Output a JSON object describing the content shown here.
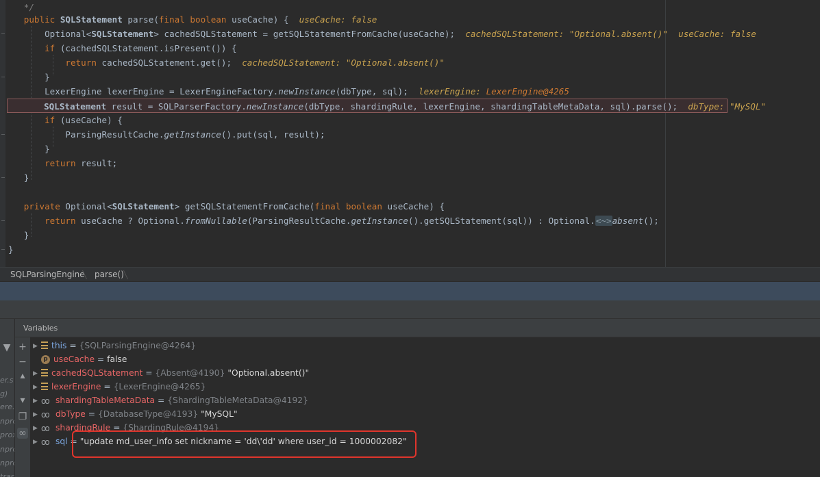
{
  "editor": {
    "lines": [
      {
        "key": "l0",
        "parts": [
          {
            "t": "   */",
            "c": "cm"
          }
        ]
      },
      {
        "key": "l1",
        "parts": [
          {
            "t": "   public ",
            "c": "kw"
          },
          {
            "t": "SQLStatement",
            "c": "bold"
          },
          {
            "t": " parse(",
            "c": ""
          },
          {
            "t": "final boolean ",
            "c": "kw"
          },
          {
            "t": "useCache) {  ",
            "c": ""
          },
          {
            "t": "useCache: false",
            "c": "hint"
          }
        ]
      },
      {
        "key": "l2",
        "parts": [
          {
            "t": "       Optional<",
            "c": ""
          },
          {
            "t": "SQLStatement",
            "c": "bold"
          },
          {
            "t": "> cachedSQLStatement = getSQLStatementFromCache(useCache);  ",
            "c": ""
          },
          {
            "t": "cachedSQLStatement: \"Optional.absent()\"  useCache: false",
            "c": "hint"
          }
        ]
      },
      {
        "key": "l3",
        "parts": [
          {
            "t": "       ",
            "c": ""
          },
          {
            "t": "if ",
            "c": "kw"
          },
          {
            "t": "(cachedSQLStatement.isPresent()) {",
            "c": ""
          }
        ]
      },
      {
        "key": "l4",
        "parts": [
          {
            "t": "           ",
            "c": ""
          },
          {
            "t": "return ",
            "c": "kw"
          },
          {
            "t": "cachedSQLStatement.get();  ",
            "c": ""
          },
          {
            "t": "cachedSQLStatement: \"Optional.absent()\"",
            "c": "hint"
          }
        ]
      },
      {
        "key": "l5",
        "parts": [
          {
            "t": "       }",
            "c": ""
          }
        ]
      },
      {
        "key": "l6",
        "parts": [
          {
            "t": "       LexerEngine lexerEngine = LexerEngineFactory.",
            "c": ""
          },
          {
            "t": "newInstance",
            "c": "it"
          },
          {
            "t": "(dbType, sql);  ",
            "c": ""
          },
          {
            "t": "lexerEngine: ",
            "c": "hint"
          },
          {
            "t": "LexerEngine@4265",
            "c": "hint-orange"
          }
        ]
      },
      {
        "key": "l7",
        "parts": [
          {
            "t": "       ",
            "c": ""
          },
          {
            "t": "SQLStatement",
            "c": "bold"
          },
          {
            "t": " result = SQLParserFactory.",
            "c": ""
          },
          {
            "t": "newInstance",
            "c": "it"
          },
          {
            "t": "(dbType, shardingRule, lexerEngine, shardingTableMetaData, sql).parse();  ",
            "c": ""
          },
          {
            "t": "dbType: \"MySQL\"",
            "c": "hint"
          }
        ]
      },
      {
        "key": "l8",
        "parts": [
          {
            "t": "       ",
            "c": ""
          },
          {
            "t": "if ",
            "c": "kw"
          },
          {
            "t": "(useCache) {",
            "c": ""
          }
        ]
      },
      {
        "key": "l9",
        "parts": [
          {
            "t": "           ParsingResultCache.",
            "c": ""
          },
          {
            "t": "getInstance",
            "c": "it"
          },
          {
            "t": "().put(sql, result);",
            "c": ""
          }
        ]
      },
      {
        "key": "l10",
        "parts": [
          {
            "t": "       }",
            "c": ""
          }
        ]
      },
      {
        "key": "l11",
        "parts": [
          {
            "t": "       ",
            "c": ""
          },
          {
            "t": "return ",
            "c": "kw"
          },
          {
            "t": "result;",
            "c": ""
          }
        ]
      },
      {
        "key": "l12",
        "parts": [
          {
            "t": "   }",
            "c": ""
          }
        ]
      },
      {
        "key": "l13",
        "parts": [
          {
            "t": "",
            "c": ""
          }
        ]
      },
      {
        "key": "l14",
        "parts": [
          {
            "t": "   private ",
            "c": "kw"
          },
          {
            "t": "Optional<",
            "c": ""
          },
          {
            "t": "SQLStatement",
            "c": "bold"
          },
          {
            "t": "> getSQLStatementFromCache(",
            "c": ""
          },
          {
            "t": "final boolean ",
            "c": "kw"
          },
          {
            "t": "useCache) {",
            "c": ""
          }
        ]
      },
      {
        "key": "l15",
        "parts": [
          {
            "t": "       ",
            "c": ""
          },
          {
            "t": "return ",
            "c": "kw"
          },
          {
            "t": "useCache ? Optional.",
            "c": ""
          },
          {
            "t": "fromNullable",
            "c": "it"
          },
          {
            "t": "(ParsingResultCache.",
            "c": ""
          },
          {
            "t": "getInstance",
            "c": "it"
          },
          {
            "t": "().getSQLStatement(sql)) : Optional.",
            "c": ""
          },
          {
            "t": "<~>",
            "c": "diamond"
          },
          {
            "t": "absent",
            "c": "it"
          },
          {
            "t": "();",
            "c": ""
          }
        ]
      },
      {
        "key": "l16",
        "parts": [
          {
            "t": "   }",
            "c": ""
          }
        ]
      },
      {
        "key": "l17",
        "parts": [
          {
            "t": "}",
            "c": ""
          }
        ]
      }
    ]
  },
  "breadcrumb": {
    "items": [
      "SQLParsingEngine",
      "parse()"
    ]
  },
  "variables": {
    "title": "Variables",
    "rows": [
      {
        "name": "this",
        "eq": " = ",
        "ref": "{SQLParsingEngine@4264}",
        "val": "",
        "icon": "field-list-icon",
        "expand": true,
        "nameColor": "blue"
      },
      {
        "name": "useCache",
        "eq": " = ",
        "ref": "",
        "val": "false",
        "icon": "parameter-icon",
        "expand": false,
        "nameColor": "red"
      },
      {
        "name": "cachedSQLStatement",
        "eq": " = ",
        "ref": "{Absent@4190}",
        "val": " \"Optional.absent()\"",
        "icon": "field-list-icon",
        "expand": true,
        "nameColor": "red"
      },
      {
        "name": "lexerEngine",
        "eq": " = ",
        "ref": "{LexerEngine@4265}",
        "val": "",
        "icon": "field-list-icon",
        "expand": true,
        "nameColor": "red"
      },
      {
        "name": "shardingTableMetaData",
        "eq": " = ",
        "ref": "{ShardingTableMetaData@4192}",
        "val": "",
        "icon": "watch-glasses-icon",
        "expand": true,
        "nameColor": "red"
      },
      {
        "name": "dbType",
        "eq": " = ",
        "ref": "{DatabaseType@4193}",
        "val": " \"MySQL\"",
        "icon": "watch-glasses-icon",
        "expand": true,
        "nameColor": "red"
      },
      {
        "name": "shardingRule",
        "eq": " = ",
        "ref": "{ShardingRule@4194}",
        "val": "",
        "icon": "watch-glasses-icon",
        "expand": true,
        "nameColor": "red"
      },
      {
        "name": "sql",
        "eq": " = ",
        "ref": "",
        "val": "\"update md_user_info set nickname = 'dd\\'dd' where user_id = 1000002082\"",
        "icon": "watch-glasses-icon",
        "expand": true,
        "nameColor": "blue"
      }
    ]
  },
  "left_strip": {
    "fragments": [
      "er.s",
      "g)",
      "ere.",
      "npro",
      "prox",
      "npro",
      "npro",
      "trar"
    ]
  },
  "colors": {
    "editor_bg": "#2b2b2b",
    "keyword": "#cc7832",
    "inline_hint": "#c8a24f",
    "current_line_border": "#8c5a5a",
    "annotation_box": "#e0352c",
    "var_name": "#e86666"
  }
}
